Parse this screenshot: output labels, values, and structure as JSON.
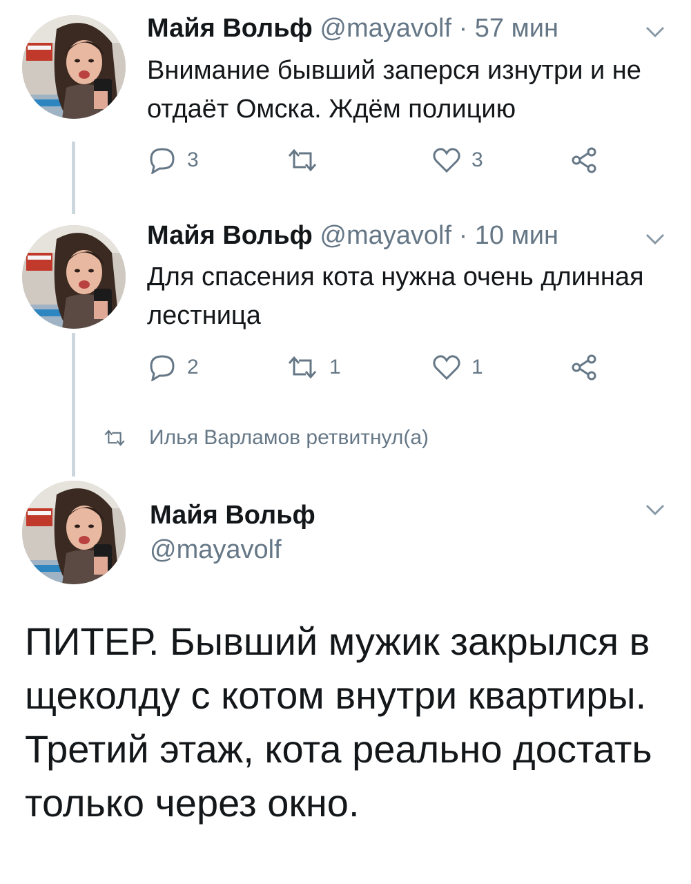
{
  "thread": [
    {
      "author_name": "Майя Вольф",
      "handle": "@mayavolf",
      "separator": "·",
      "time": "57 мин",
      "text": "Внимание бывший заперся изнутри и не отдаёт Омска. Ждём полицию",
      "reply_count": "3",
      "retweet_count": "",
      "like_count": "3"
    },
    {
      "author_name": "Майя Вольф",
      "handle": "@mayavolf",
      "separator": "·",
      "time": "10 мин",
      "text": "Для спасения кота нужна очень длинная лестница",
      "reply_count": "2",
      "retweet_count": "1",
      "like_count": "1"
    }
  ],
  "retweet_note": "Илья Варламов ретвитнул(а)",
  "main_tweet": {
    "author_name": "Майя Вольф",
    "handle": "@mayavolf",
    "text": "ПИТЕР. Бывший мужик закрылся в щеколду с котом внутри квартиры. Третий этаж, кота реально достать только через окно."
  },
  "icons": {
    "reply": "reply-icon",
    "retweet": "retweet-icon",
    "like": "heart-icon",
    "share": "share-icon",
    "menu": "chevron-down-icon"
  },
  "colors": {
    "text": "#14171a",
    "secondary": "#657786",
    "thread_line": "#ccd6dd",
    "background": "#ffffff"
  }
}
